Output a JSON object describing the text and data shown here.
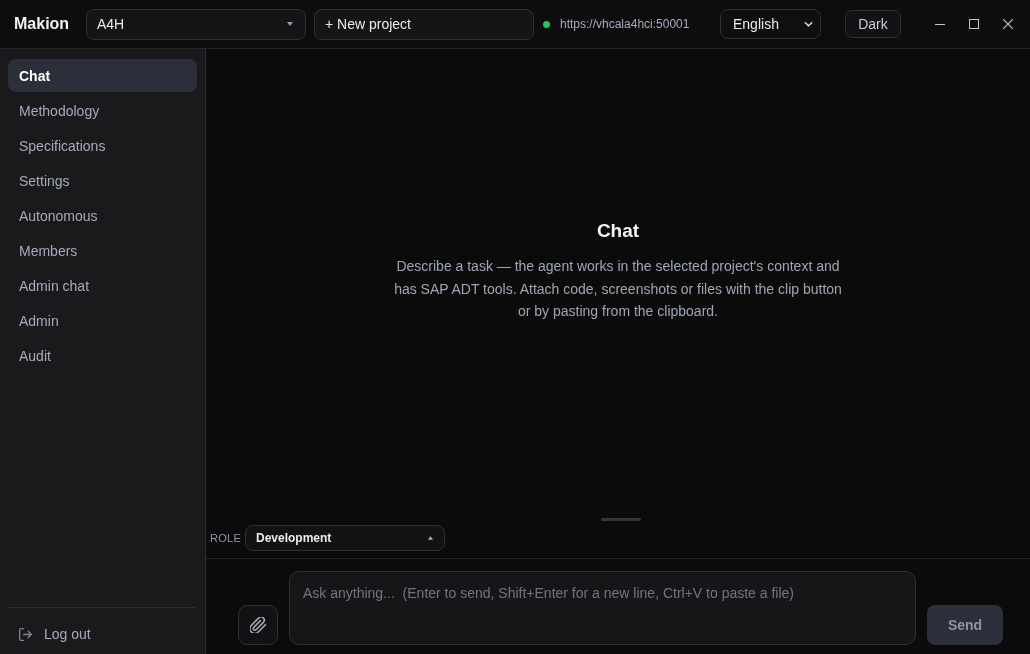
{
  "app": {
    "name": "Makion"
  },
  "header": {
    "project_select": {
      "value": "A4H"
    },
    "new_project_button": "+ New project",
    "connection": {
      "connected": true,
      "url": "https://vhcala4hci:50001"
    },
    "language_select": {
      "value": "English"
    },
    "theme_button": "Dark"
  },
  "sidebar": {
    "items": [
      {
        "label": "Chat",
        "selected": true
      },
      {
        "label": "Methodology",
        "selected": false
      },
      {
        "label": "Specifications",
        "selected": false
      },
      {
        "label": "Settings",
        "selected": false
      },
      {
        "label": "Autonomous",
        "selected": false
      },
      {
        "label": "Members",
        "selected": false
      },
      {
        "label": "Admin chat",
        "selected": false
      },
      {
        "label": "Admin",
        "selected": false
      },
      {
        "label": "Audit",
        "selected": false
      }
    ],
    "logout": "Log out"
  },
  "main": {
    "title": "Chat",
    "description": "Describe a task — the agent works in the selected project's context and has SAP ADT tools. Attach code, screenshots or files with the clip button or by pasting from the clipboard."
  },
  "composer": {
    "role_label": "ROLE",
    "role_select": {
      "value": "Development"
    },
    "input": {
      "placeholder": "Ask anything...  (Enter to send, Shift+Enter for a new line, Ctrl+V to paste a file)"
    },
    "send_button": {
      "label": "Send",
      "disabled": true
    }
  }
}
